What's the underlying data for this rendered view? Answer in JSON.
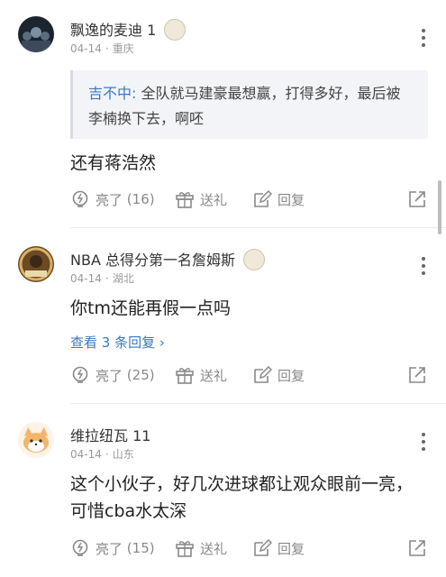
{
  "comments": [
    {
      "username": "飘逸的麦迪",
      "level": "1",
      "date": "04-14",
      "location": "重庆",
      "quote": {
        "name": "吉不中:",
        "text": " 全队就马建豪最想赢，打得多好，最后被李楠换下去，啊呸"
      },
      "text": "还有蒋浩然",
      "like_label": "亮了",
      "like_count": "(16)",
      "gift_label": "送礼",
      "reply_label": "回复"
    },
    {
      "username": "NBA 总得分第一名詹姆斯",
      "date": "04-14",
      "location": "湖北",
      "text": "你tm还能再假一点吗",
      "view_replies": "查看 3 条回复",
      "like_label": "亮了",
      "like_count": "(25)",
      "gift_label": "送礼",
      "reply_label": "回复"
    },
    {
      "username": "维拉纽瓦 11",
      "date": "04-14",
      "location": "山东",
      "text": "这个小伙子，好几次进球都让观众眼前一亮，可惜cba水太深",
      "like_label": "亮了",
      "like_count": "(15)",
      "gift_label": "送礼",
      "reply_label": "回复"
    }
  ],
  "colors": {
    "link": "#3a78c4",
    "muted": "#999999",
    "quote_bg": "#f3f4f7"
  },
  "icons": [
    "lightbulb-icon",
    "gift-icon",
    "reply-edit-icon",
    "share-icon",
    "more-vertical-icon"
  ]
}
